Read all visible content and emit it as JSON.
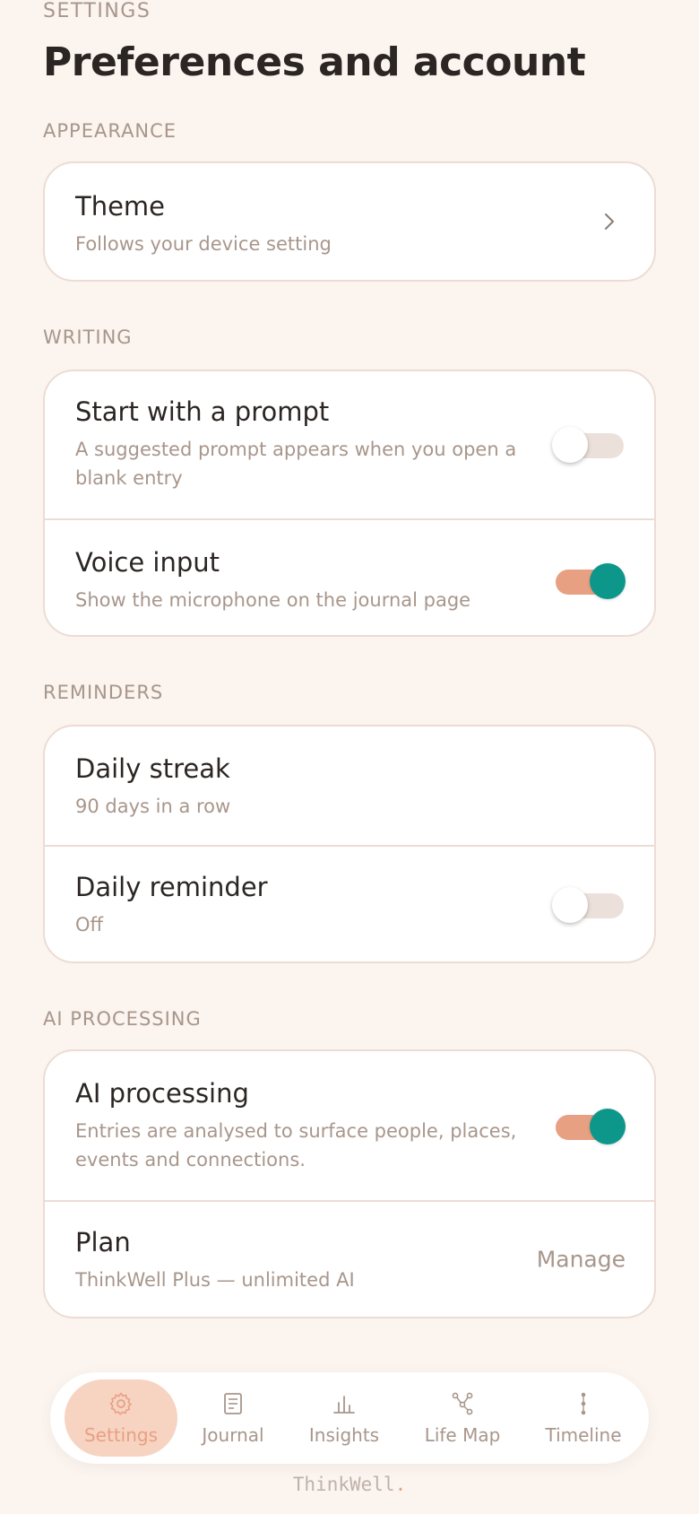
{
  "header": {
    "eyebrow": "SETTINGS",
    "title": "Preferences and account"
  },
  "sections": {
    "appearance": {
      "label": "APPEARANCE",
      "theme": {
        "title": "Theme",
        "subtitle": "Follows your device setting",
        "icon": "chevron-right-icon"
      }
    },
    "writing": {
      "label": "WRITING",
      "prompt": {
        "title": "Start with a prompt",
        "subtitle": "A suggested prompt appears when you open a blank entry",
        "enabled": false
      },
      "voice": {
        "title": "Voice input",
        "subtitle": "Show the microphone on the journal page",
        "enabled": true
      }
    },
    "reminders": {
      "label": "REMINDERS",
      "streak": {
        "title": "Daily streak",
        "subtitle": "90 days in a row"
      },
      "reminder": {
        "title": "Daily reminder",
        "subtitle": "Off",
        "enabled": false
      }
    },
    "ai": {
      "label": "AI PROCESSING",
      "processing": {
        "title": "AI processing",
        "subtitle": "Entries are analysed to surface people, places, events and connections.",
        "enabled": true
      },
      "plan": {
        "title": "Plan",
        "subtitle": "ThinkWell Plus — unlimited AI",
        "action": "Manage"
      }
    }
  },
  "nav": {
    "items": [
      {
        "label": "Settings",
        "icon": "gear-icon",
        "active": true
      },
      {
        "label": "Journal",
        "icon": "journal-icon",
        "active": false
      },
      {
        "label": "Insights",
        "icon": "bar-chart-icon",
        "active": false
      },
      {
        "label": "Life Map",
        "icon": "graph-icon",
        "active": false
      },
      {
        "label": "Timeline",
        "icon": "timeline-icon",
        "active": false
      }
    ]
  },
  "brand": {
    "name": "ThinkWell",
    "dot": "."
  },
  "colors": {
    "background": "#fbf4ef",
    "accent": "#e8a083",
    "toggle_on": "#0d978a",
    "muted_text": "#a8968b",
    "border": "#ecdcd3"
  }
}
